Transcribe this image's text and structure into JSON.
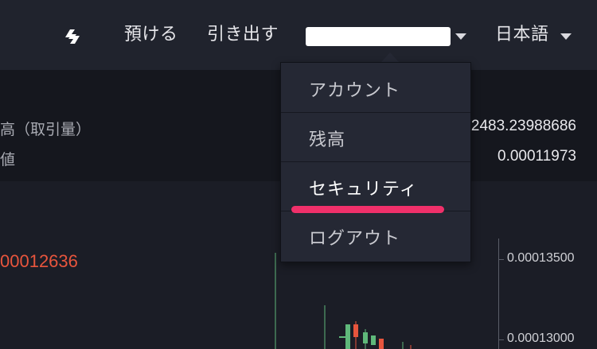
{
  "header": {
    "deposit_label": "預ける",
    "withdraw_label": "引き出す",
    "account_name": "",
    "language_label": "日本語"
  },
  "account_menu": {
    "items": [
      {
        "label": "アカウント"
      },
      {
        "label": "残高"
      },
      {
        "label": "セキュリティ"
      },
      {
        "label": "ログアウト"
      }
    ],
    "highlighted_item": "セキュリティ",
    "highlight_color": "#f0306a"
  },
  "info_panel": {
    "row1_label": "高（取引量）",
    "row1_value": "2483.23988686",
    "row2_label": "値",
    "row2_value": "0.00011973"
  },
  "chart": {
    "last_price": "00012636",
    "last_price_color": "#e8553d",
    "y_tick_labels": [
      "0.00013500",
      "0.00013000"
    ],
    "up_color": "#5fb87a",
    "down_color": "#e8553d"
  },
  "colors": {
    "background": "#1b1d26",
    "header_bg": "#20232d",
    "dropdown_bg": "#252834"
  },
  "icons": {
    "sync": "sync-icon",
    "account_caret": "caret-down-icon",
    "language_caret": "caret-down-icon"
  }
}
